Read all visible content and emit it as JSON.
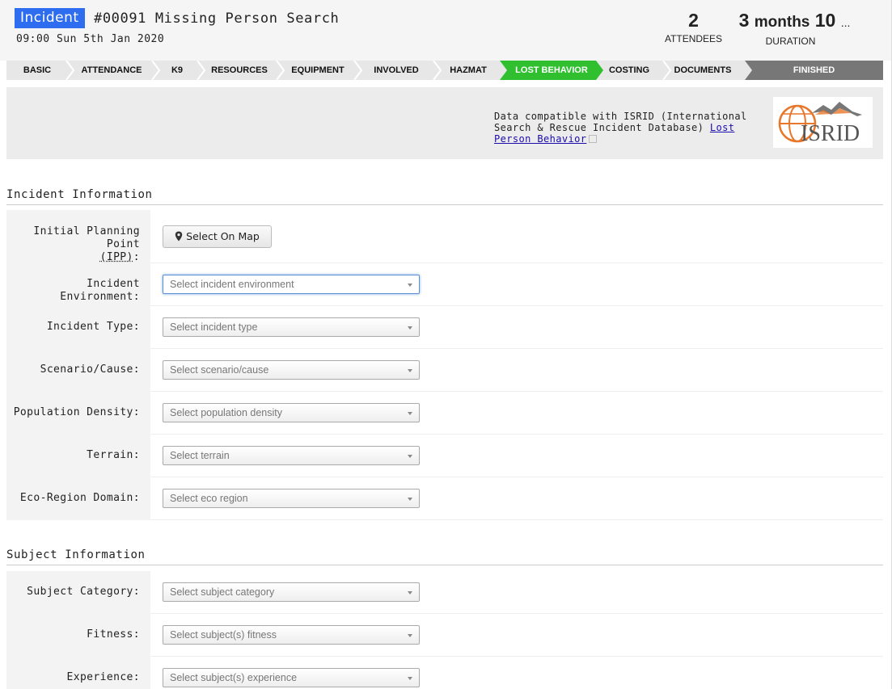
{
  "header": {
    "badge": "Incident",
    "title": "#00091 Missing Person Search",
    "subtitle": "09:00 Sun 5th Jan 2020",
    "attendees_value": "2",
    "attendees_label": "ATTENDEES",
    "duration_value_num": "3",
    "duration_value_unit": "months",
    "duration_value_rest": "10",
    "duration_ellipsis": "...",
    "duration_label": "DURATION"
  },
  "steps": {
    "basic": "BASIC",
    "attendance": "ATTENDANCE",
    "k9": "K9",
    "resources": "RESOURCES",
    "equipment": "EQUIPMENT",
    "involved": "INVOLVED",
    "hazmat": "HAZMAT",
    "lost_behavior": "LOST BEHAVIOR",
    "costing": "COSTING",
    "documents": "DOCUMENTS",
    "finished": "FINISHED"
  },
  "info": {
    "text": "Data compatible with ISRID (International Search & Rescue Incident Database)",
    "link": "Lost Person Behavior",
    "logo_text": "ISRID"
  },
  "incident_section": {
    "title": "Incident Information",
    "ipp_label": "Initial Planning Point",
    "ipp_abbr": "(IPP)",
    "ipp_colon": ":",
    "select_on_map": "Select On Map",
    "rows": [
      {
        "label": "Incident Environment:",
        "placeholder": "Select incident environment"
      },
      {
        "label": "Incident Type:",
        "placeholder": "Select incident type"
      },
      {
        "label": "Scenario/Cause:",
        "placeholder": "Select scenario/cause"
      },
      {
        "label": "Population Density:",
        "placeholder": "Select population density"
      },
      {
        "label": "Terrain:",
        "placeholder": "Select terrain"
      },
      {
        "label": "Eco-Region Domain:",
        "placeholder": "Select eco region"
      }
    ]
  },
  "subject_section": {
    "title": "Subject Information",
    "rows": [
      {
        "label": "Subject Category:",
        "placeholder": "Select subject category"
      },
      {
        "label": "Fitness:",
        "placeholder": "Select subject(s) fitness"
      },
      {
        "label": "Experience:",
        "placeholder": "Select subject(s) experience"
      }
    ]
  },
  "colors": {
    "badge": "#2e6cf0",
    "active_step": "#2fbf2f",
    "finished_step": "#777777",
    "logo_orange": "#e8762b"
  }
}
